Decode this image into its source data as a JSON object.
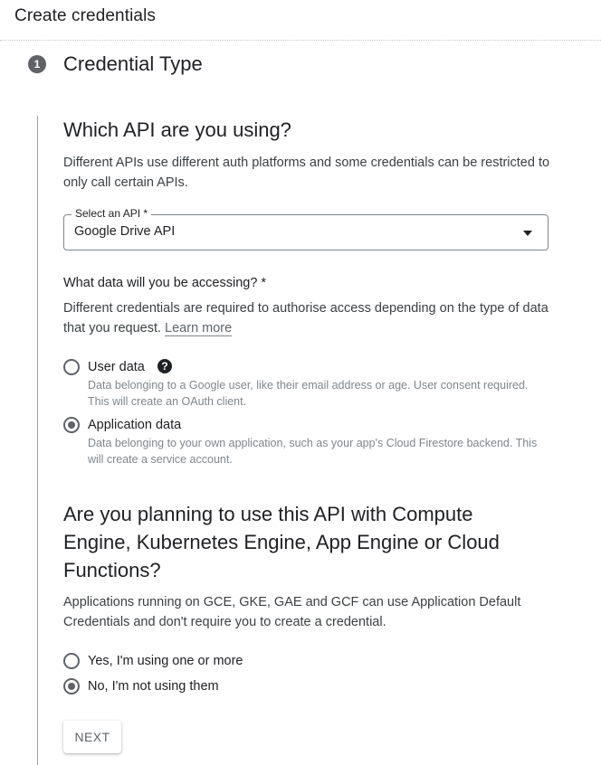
{
  "header": {
    "title": "Create credentials"
  },
  "step": {
    "number": "1",
    "title": "Credential Type"
  },
  "api_section": {
    "heading": "Which API are you using?",
    "description": "Different APIs use different auth platforms and some credentials can be restricted to only call certain APIs.",
    "select": {
      "label": "Select an API *",
      "value": "Google Drive API"
    }
  },
  "data_section": {
    "label": "What data will you be accessing? *",
    "description": "Different credentials are required to authorise access depending on the type of data that you request.",
    "learn_more": "Learn more",
    "options": [
      {
        "label": "User data",
        "description": "Data belonging to a Google user, like their email address or age. User consent required. This will create an OAuth client.",
        "checked": false
      },
      {
        "label": "Application data",
        "description": "Data belonging to your own application, such as your app's Cloud Firestore backend. This will create a service account.",
        "checked": true
      }
    ]
  },
  "compute_section": {
    "heading": "Are you planning to use this API with Compute Engine, Kubernetes Engine, App Engine or Cloud Functions?",
    "description": "Applications running on GCE, GKE, GAE and GCF can use Application Default Credentials and don't require you to create a credential.",
    "options": [
      {
        "label": "Yes, I'm using one or more",
        "checked": false
      },
      {
        "label": "No, I'm not using them",
        "checked": true
      }
    ]
  },
  "actions": {
    "next_label": "NEXT"
  }
}
